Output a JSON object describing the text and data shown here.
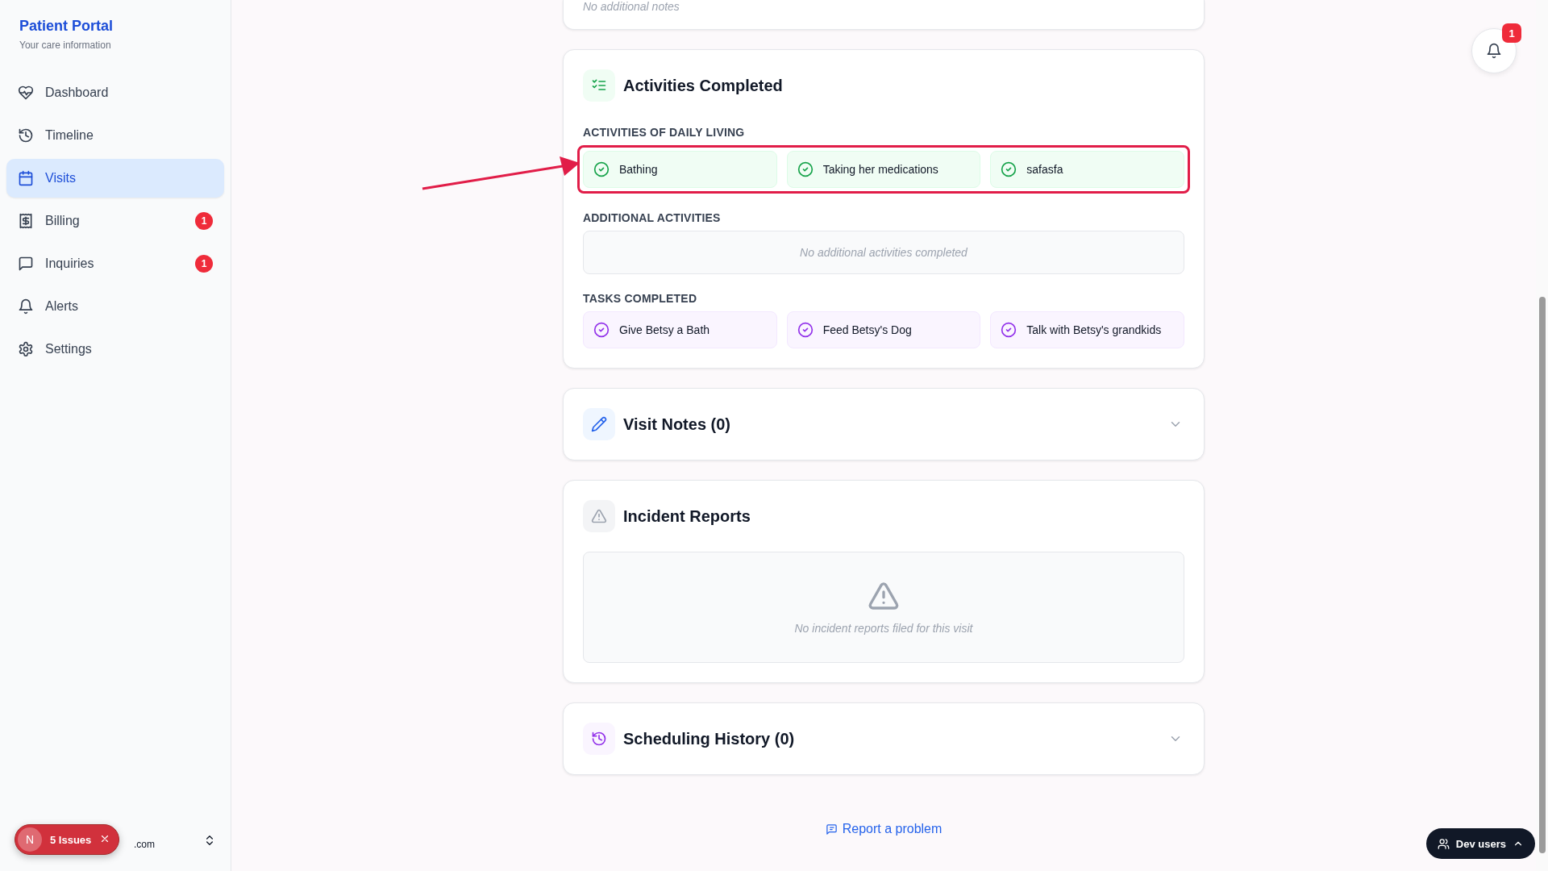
{
  "sidebar": {
    "title": "Patient Portal",
    "subtitle": "Your care information",
    "items": [
      {
        "label": "Dashboard",
        "selected": false
      },
      {
        "label": "Timeline",
        "selected": false
      },
      {
        "label": "Visits",
        "selected": true
      },
      {
        "label": "Billing",
        "selected": false,
        "badge": "1"
      },
      {
        "label": "Inquiries",
        "selected": false,
        "badge": "1"
      },
      {
        "label": "Alerts",
        "selected": false
      },
      {
        "label": "Settings",
        "selected": false
      }
    ],
    "user_email": ".com"
  },
  "issues_badge": {
    "letter": "N",
    "label": "5 Issues"
  },
  "notes_card": {
    "empty_text": "No additional notes"
  },
  "activities": {
    "title": "Activities Completed",
    "groups": [
      {
        "heading": "ACTIVITIES OF DAILY LIVING",
        "kind": "adl",
        "highlighted": true,
        "items": [
          "Bathing",
          "Taking her medications",
          "safasfa"
        ]
      },
      {
        "heading": "ADDITIONAL ACTIVITIES",
        "kind": "empty",
        "empty_text": "No additional activities completed"
      },
      {
        "heading": "TASKS COMPLETED",
        "kind": "task",
        "items": [
          "Give Betsy a Bath",
          "Feed Betsy's Dog",
          "Talk with Betsy's grandkids"
        ]
      }
    ]
  },
  "visit_notes": {
    "title": "Visit Notes (0)",
    "expanded": false
  },
  "incident_reports": {
    "title": "Incident Reports",
    "empty_text": "No incident reports filed for this visit"
  },
  "scheduling_history": {
    "title": "Scheduling History (0)",
    "expanded": false
  },
  "report_link": "Report a problem",
  "notifications": {
    "count": "1"
  },
  "dev_users": {
    "label": "Dev users"
  }
}
